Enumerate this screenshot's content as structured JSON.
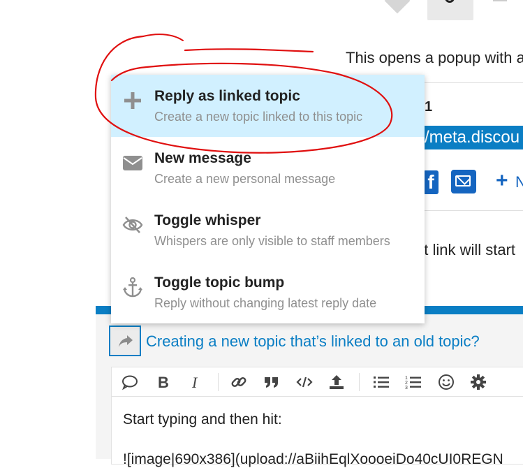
{
  "background": {
    "intro_text": "This opens a popup with a",
    "after_text": "at link will start"
  },
  "share_popup": {
    "number": "1",
    "url_text": "/meta.discou",
    "fb_letter": "f",
    "plus_letter": "+",
    "more_letter": "N"
  },
  "menu": {
    "items": [
      {
        "title": "Reply as linked topic",
        "desc": "Create a new topic linked to this topic",
        "icon": "plus-icon",
        "highlighted": true
      },
      {
        "title": "New message",
        "desc": "Create a new personal message",
        "icon": "envelope-icon",
        "highlighted": false
      },
      {
        "title": "Toggle whisper",
        "desc": "Whispers are only visible to staff members",
        "icon": "eye-slash-icon",
        "highlighted": false
      },
      {
        "title": "Toggle topic bump",
        "desc": "Reply without changing latest reply date",
        "icon": "anchor-icon",
        "highlighted": false
      }
    ]
  },
  "composer": {
    "topic_title": "Creating a new topic that’s linked to an old topic?",
    "editor_line1": "Start typing and then hit:",
    "editor_line2": "![image|690x386](upload://aBiihEqlXoooeiDo40cUI0REGN"
  },
  "colors": {
    "accent": "#0a7ec4",
    "highlight": "#d1f0ff",
    "annotation": "#e01010",
    "share_blue": "#1565c0"
  }
}
